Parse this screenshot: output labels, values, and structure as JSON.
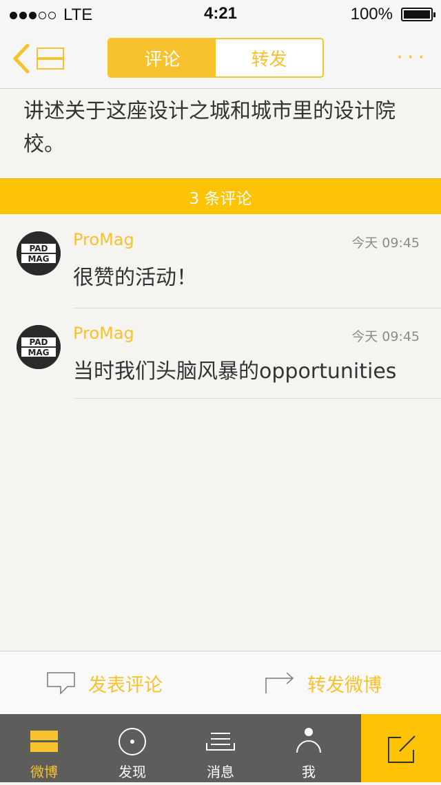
{
  "statusbar": {
    "carrier": "LTE",
    "time": "4:21",
    "battery": "100%",
    "signal_bars_filled": 3,
    "signal_bars_total": 5
  },
  "navbar": {
    "tabs": [
      {
        "label": "评论",
        "active": true
      },
      {
        "label": "转发",
        "active": false
      }
    ],
    "more_label": "···"
  },
  "post": {
    "text": "讲述关于这座设计之城和城市里的设计院校。"
  },
  "comments_header": "3 条评论",
  "comments": [
    {
      "author": "ProMag",
      "time": "今天 09:45",
      "text": "很赞的活动！"
    },
    {
      "author": "ProMag",
      "time": "今天 09:45",
      "text": "当时我们头脑风暴的opportunities"
    }
  ],
  "avatar_logo": [
    "PAD",
    "MAG"
  ],
  "actions": {
    "comment_label": "发表评论",
    "repost_label": "转发微博"
  },
  "tabbar": {
    "items": [
      {
        "label": "微博",
        "icon": "home-stack-icon",
        "active": true
      },
      {
        "label": "发现",
        "icon": "discover-icon",
        "active": false
      },
      {
        "label": "消息",
        "icon": "inbox-icon",
        "active": false
      },
      {
        "label": "我",
        "icon": "profile-icon",
        "active": false
      }
    ],
    "compose_icon": "compose-icon"
  },
  "colors": {
    "accent": "#f7c22d",
    "accent_bar": "#fec304",
    "tabbar_bg": "#5d5d5b"
  }
}
